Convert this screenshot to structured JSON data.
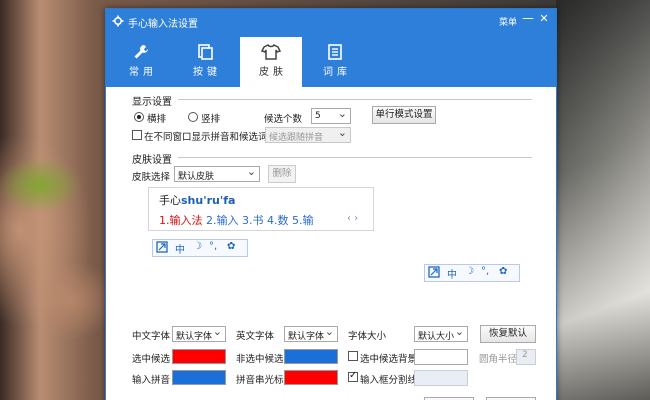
{
  "window": {
    "title": "手心输入法设置",
    "menu_label": "菜单",
    "minimize_glyph": "—",
    "close_glyph": "✕"
  },
  "tabs": [
    {
      "label": "常用",
      "icon": "wrench-icon",
      "active": false
    },
    {
      "label": "按键",
      "icon": "keys-icon",
      "active": false
    },
    {
      "label": "皮肤",
      "icon": "shirt-icon",
      "active": true
    },
    {
      "label": "词库",
      "icon": "document-icon",
      "active": false
    }
  ],
  "display": {
    "section_title": "显示设置",
    "horizontal_label": "横排",
    "vertical_label": "竖排",
    "orientation": "横排",
    "candidate_count_label": "候选个数",
    "candidate_count_value": "5",
    "single_line_button": "单行模式设置",
    "show_pinyin_label": "在不同窗口显示拼音和候选词",
    "show_pinyin_checked": false,
    "follow_pinyin_select": "候选跟随拼音"
  },
  "skin": {
    "section_title": "皮肤设置",
    "choose_label": "皮肤选择",
    "choose_value": "默认皮肤",
    "delete_button": "删除",
    "preview": {
      "composition_prefix": "手心",
      "composition_pinyin": "shu'ru'fa",
      "candidates": [
        {
          "text": "1.输入法",
          "selected": true
        },
        {
          "text": "2.输入",
          "selected": false
        },
        {
          "text": "3.书",
          "selected": false
        },
        {
          "text": "4.数",
          "selected": false
        },
        {
          "text": "5.输",
          "selected": false
        }
      ],
      "prev_glyph": "‹",
      "next_glyph": "›"
    },
    "status_bar": {
      "mode_char": "中",
      "moon_glyph": "☽",
      "punct_glyph": "°,",
      "gear_glyph": "✿"
    }
  },
  "fonts": {
    "cn_font_label": "中文字体",
    "cn_font_value": "默认字体",
    "en_font_label": "英文字体",
    "en_font_value": "默认字体",
    "size_label": "字体大小",
    "size_value": "默认大小",
    "restore_button": "恢复默认"
  },
  "colors": {
    "selected_candidate_label": "选中候选",
    "selected_candidate_color": "#ff0000",
    "unselected_candidate_label": "非选中候选",
    "unselected_candidate_color": "#1a6fd8",
    "selected_bg_label": "选中候选背景",
    "selected_bg_checked": false,
    "corner_radius_label": "圆角半径",
    "corner_radius_value": "2",
    "input_pinyin_label": "输入拼音",
    "input_pinyin_color": "#1a6fd8",
    "pinyin_cursor_label": "拼音串光标",
    "pinyin_cursor_color": "#ff0000",
    "divider_label": "输入框分割线",
    "divider_checked": true
  }
}
